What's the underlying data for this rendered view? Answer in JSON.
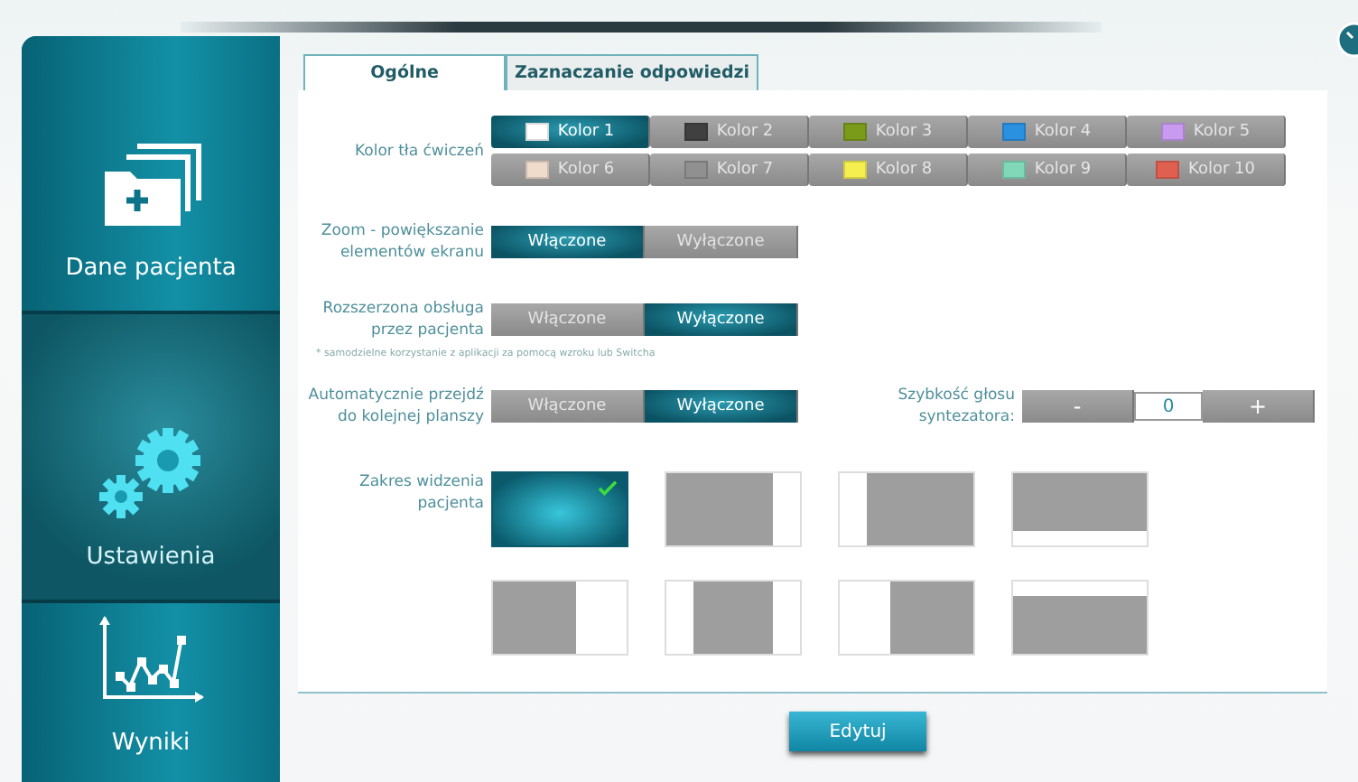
{
  "sidebar": {
    "items": [
      {
        "label": "Dane pacjenta",
        "kind": "folders",
        "selected": false
      },
      {
        "label": "Ustawienia",
        "kind": "gears",
        "selected": true
      },
      {
        "label": "Wyniki",
        "kind": "chart",
        "selected": false
      }
    ]
  },
  "tabs": [
    {
      "label": "Ogólne",
      "selected": true
    },
    {
      "label": "Zaznaczanie odpowiedzi",
      "selected": false
    }
  ],
  "background_color": {
    "label": "Kolor tła ćwiczeń",
    "options": [
      {
        "label": "Kolor 1",
        "color": "#ffffff",
        "selected": true
      },
      {
        "label": "Kolor 2",
        "color": "#404040",
        "selected": false
      },
      {
        "label": "Kolor 3",
        "color": "#7a9a1a",
        "selected": false
      },
      {
        "label": "Kolor 4",
        "color": "#2a90e0",
        "selected": false
      },
      {
        "label": "Kolor 5",
        "color": "#c89af0",
        "selected": false
      },
      {
        "label": "Kolor 6",
        "color": "#f0dccb",
        "selected": false
      },
      {
        "label": "Kolor 7",
        "color": "#909090",
        "selected": false
      },
      {
        "label": "Kolor 8",
        "color": "#f5f050",
        "selected": false
      },
      {
        "label": "Kolor 9",
        "color": "#80d8b8",
        "selected": false
      },
      {
        "label": "Kolor 10",
        "color": "#e06050",
        "selected": false
      }
    ]
  },
  "toggles": [
    {
      "label": "Zoom - powiększanie elementów ekranu",
      "options": [
        {
          "label": "Włączone",
          "selected": true
        },
        {
          "label": "Wyłączone",
          "selected": false
        }
      ]
    },
    {
      "label": "Rozszerzona obsługa przez pacjenta",
      "note": "* samodzielne korzystanie z aplikacji za pomocą wzroku lub Switcha",
      "options": [
        {
          "label": "Włączone",
          "selected": false
        },
        {
          "label": "Wyłączone",
          "selected": true
        }
      ]
    },
    {
      "label": "Automatycznie przejdź do kolejnej planszy",
      "options": [
        {
          "label": "Włączone",
          "selected": false
        },
        {
          "label": "Wyłączone",
          "selected": true
        }
      ]
    }
  ],
  "speech_rate": {
    "label": "Szybkość głosu syntezatora:",
    "decrease": "-",
    "value": "0",
    "increase": "+"
  },
  "view_range": {
    "label": "Zakres widzenia pacjenta",
    "options": [
      {
        "kind": "full",
        "selected": true
      },
      {
        "kind": "blank-right",
        "selected": false
      },
      {
        "kind": "blank-left",
        "selected": false
      },
      {
        "kind": "blank-bottom",
        "selected": false
      },
      {
        "kind": "blank-right-wide",
        "selected": false
      },
      {
        "kind": "blank-sides",
        "selected": false
      },
      {
        "kind": "blank-left-wide",
        "selected": false
      },
      {
        "kind": "blank-top",
        "selected": false
      }
    ]
  },
  "buttons": [
    "Edytuj"
  ]
}
